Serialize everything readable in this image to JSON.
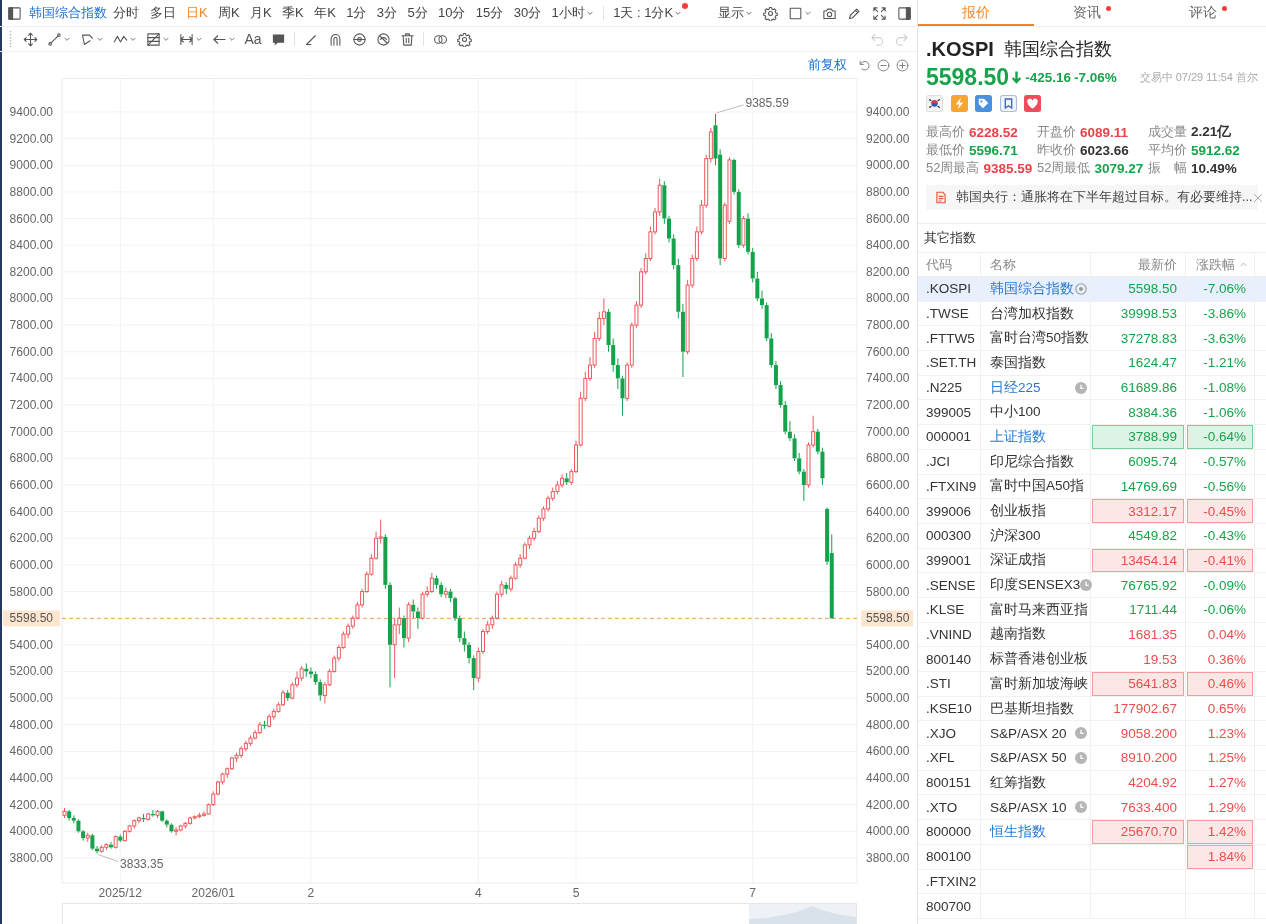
{
  "toolbar": {
    "title": "韩国综合指数",
    "periods": [
      {
        "label": "分时",
        "selected": false,
        "dropdown": false
      },
      {
        "label": "多日",
        "selected": false,
        "dropdown": false
      },
      {
        "label": "日K",
        "selected": true,
        "dropdown": false
      },
      {
        "label": "周K",
        "selected": false,
        "dropdown": false
      },
      {
        "label": "月K",
        "selected": false,
        "dropdown": false
      },
      {
        "label": "季K",
        "selected": false,
        "dropdown": false
      },
      {
        "label": "年K",
        "selected": false,
        "dropdown": false
      },
      {
        "label": "1分",
        "selected": false,
        "dropdown": false
      },
      {
        "label": "3分",
        "selected": false,
        "dropdown": false
      },
      {
        "label": "5分",
        "selected": false,
        "dropdown": false
      },
      {
        "label": "10分",
        "selected": false,
        "dropdown": false
      },
      {
        "label": "15分",
        "selected": false,
        "dropdown": false
      },
      {
        "label": "30分",
        "selected": false,
        "dropdown": false
      },
      {
        "label": "1小时",
        "selected": false,
        "dropdown": true
      }
    ],
    "interval": {
      "label": "1天 : 1分K",
      "unread": true
    },
    "display_menu": {
      "label": "显示"
    }
  },
  "drawing_toolbar": {
    "text_tool": "Aa",
    "undo": {
      "disabled": true
    },
    "redo": {
      "disabled": true
    }
  },
  "chart": {
    "adjustment": "前复权",
    "right_price_tag": "5598.50",
    "chart_data": [
      {
        "type": "candlestick",
        "categories": [
          null,
          null,
          null,
          null,
          null,
          null,
          null,
          null,
          null,
          null,
          null,
          null,
          "2025/12",
          null,
          null,
          null,
          null,
          null,
          null,
          null,
          null,
          null,
          null,
          null,
          null,
          null,
          null,
          null,
          null,
          null,
          null,
          null,
          "2026/01",
          null,
          null,
          null,
          null,
          null,
          null,
          null,
          null,
          null,
          null,
          null,
          null,
          null,
          null,
          null,
          null,
          null,
          null,
          null,
          null,
          "2",
          null,
          null,
          null,
          null,
          null,
          null,
          null,
          null,
          null,
          null,
          null,
          null,
          null,
          null,
          null,
          null,
          null,
          null,
          null,
          null,
          null,
          null,
          null,
          null,
          null,
          null,
          null,
          null,
          null,
          null,
          null,
          null,
          null,
          null,
          null,
          "4",
          null,
          null,
          null,
          null,
          null,
          null,
          null,
          null,
          null,
          null,
          null,
          null,
          null,
          null,
          null,
          null,
          null,
          null,
          null,
          null,
          "5",
          null,
          null,
          null,
          null,
          null,
          null,
          null,
          null,
          null,
          null,
          null,
          null,
          null,
          null,
          null,
          null,
          null,
          null,
          null,
          null,
          null,
          null,
          null,
          null,
          null,
          null,
          null,
          null,
          null,
          null,
          null,
          null,
          null,
          null,
          null,
          null,
          null,
          "7",
          null,
          null,
          null,
          null,
          null,
          null,
          null,
          null,
          null,
          null,
          null,
          null,
          null,
          null,
          null,
          null,
          null
        ],
        "ohlc": [
          [
            4120,
            4175,
            4100,
            4150
          ],
          [
            4150,
            4160,
            4080,
            4100
          ],
          [
            4100,
            4120,
            4060,
            4080
          ],
          [
            4080,
            4090,
            3990,
            4000
          ],
          [
            4000,
            4010,
            3930,
            3950
          ],
          [
            3950,
            3990,
            3920,
            3970
          ],
          [
            3970,
            3980,
            3860,
            3870
          ],
          [
            3870,
            3890,
            3833.35,
            3850
          ],
          [
            3850,
            3895,
            3840,
            3880
          ],
          [
            3880,
            3910,
            3860,
            3900
          ],
          [
            3900,
            3920,
            3870,
            3880
          ],
          [
            3880,
            3970,
            3870,
            3960
          ],
          [
            3960,
            3975,
            3920,
            3930
          ],
          [
            3930,
            4010,
            3925,
            4000
          ],
          [
            4000,
            4050,
            3990,
            4040
          ],
          [
            4040,
            4090,
            4020,
            4080
          ],
          [
            4080,
            4110,
            4060,
            4100
          ],
          [
            4100,
            4130,
            4070,
            4090
          ],
          [
            4090,
            4140,
            4080,
            4130
          ],
          [
            4130,
            4160,
            4110,
            4120
          ],
          [
            4120,
            4160,
            4100,
            4150
          ],
          [
            4150,
            4155,
            4070,
            4080
          ],
          [
            4080,
            4090,
            4030,
            4050
          ],
          [
            4050,
            4060,
            3990,
            4000
          ],
          [
            4000,
            4030,
            3970,
            4010
          ],
          [
            4010,
            4050,
            4000,
            4040
          ],
          [
            4040,
            4070,
            4020,
            4060
          ],
          [
            4060,
            4110,
            4050,
            4100
          ],
          [
            4100,
            4120,
            4090,
            4110
          ],
          [
            4110,
            4140,
            4100,
            4120
          ],
          [
            4120,
            4150,
            4110,
            4130
          ],
          [
            4130,
            4210,
            4125,
            4200
          ],
          [
            4200,
            4300,
            4190,
            4280
          ],
          [
            4280,
            4380,
            4270,
            4370
          ],
          [
            4370,
            4440,
            4350,
            4430
          ],
          [
            4430,
            4480,
            4400,
            4470
          ],
          [
            4470,
            4560,
            4460,
            4550
          ],
          [
            4550,
            4590,
            4520,
            4570
          ],
          [
            4570,
            4640,
            4550,
            4620
          ],
          [
            4620,
            4680,
            4600,
            4660
          ],
          [
            4660,
            4720,
            4640,
            4700
          ],
          [
            4700,
            4760,
            4690,
            4740
          ],
          [
            4740,
            4820,
            4730,
            4800
          ],
          [
            4800,
            4830,
            4770,
            4790
          ],
          [
            4790,
            4880,
            4780,
            4860
          ],
          [
            4860,
            4920,
            4840,
            4900
          ],
          [
            4900,
            4970,
            4890,
            4950
          ],
          [
            4950,
            5060,
            4940,
            5040
          ],
          [
            5040,
            5060,
            4980,
            5000
          ],
          [
            5000,
            5120,
            4990,
            5100
          ],
          [
            5100,
            5200,
            5080,
            5150
          ],
          [
            5150,
            5240,
            5130,
            5220
          ],
          [
            5220,
            5260,
            5160,
            5200
          ],
          [
            5200,
            5230,
            5150,
            5180
          ],
          [
            5180,
            5200,
            5100,
            5120
          ],
          [
            5120,
            5140,
            4980,
            5020
          ],
          [
            5020,
            5120,
            4960,
            5100
          ],
          [
            5100,
            5220,
            5090,
            5200
          ],
          [
            5200,
            5320,
            5190,
            5300
          ],
          [
            5300,
            5400,
            5280,
            5380
          ],
          [
            5380,
            5500,
            5370,
            5480
          ],
          [
            5480,
            5560,
            5450,
            5540
          ],
          [
            5540,
            5620,
            5520,
            5600
          ],
          [
            5600,
            5720,
            5590,
            5700
          ],
          [
            5700,
            5820,
            5680,
            5800
          ],
          [
            5800,
            5950,
            5790,
            5930
          ],
          [
            5930,
            6080,
            5920,
            6050
          ],
          [
            6050,
            6250,
            6040,
            6200
          ],
          [
            6200,
            6340,
            6160,
            6210
          ],
          [
            6210,
            6230,
            5820,
            5850
          ],
          [
            5850,
            5870,
            5080,
            5400
          ],
          [
            5400,
            5600,
            5150,
            5550
          ],
          [
            5550,
            5680,
            5480,
            5600
          ],
          [
            5600,
            5620,
            5380,
            5450
          ],
          [
            5450,
            5720,
            5420,
            5700
          ],
          [
            5700,
            5740,
            5600,
            5650
          ],
          [
            5650,
            5680,
            5520,
            5600
          ],
          [
            5600,
            5800,
            5590,
            5780
          ],
          [
            5780,
            5840,
            5760,
            5800
          ],
          [
            5800,
            5940,
            5790,
            5900
          ],
          [
            5900,
            5920,
            5820,
            5850
          ],
          [
            5850,
            5870,
            5760,
            5780
          ],
          [
            5780,
            5830,
            5750,
            5800
          ],
          [
            5800,
            5820,
            5720,
            5750
          ],
          [
            5750,
            5760,
            5580,
            5600
          ],
          [
            5600,
            5620,
            5420,
            5450
          ],
          [
            5450,
            5500,
            5350,
            5400
          ],
          [
            5400,
            5420,
            5260,
            5300
          ],
          [
            5300,
            5320,
            5060,
            5150
          ],
          [
            5150,
            5380,
            5120,
            5350
          ],
          [
            5350,
            5520,
            5330,
            5500
          ],
          [
            5500,
            5580,
            5480,
            5550
          ],
          [
            5550,
            5620,
            5520,
            5600
          ],
          [
            5600,
            5800,
            5590,
            5780
          ],
          [
            5780,
            5880,
            5760,
            5850
          ],
          [
            5850,
            5870,
            5780,
            5820
          ],
          [
            5820,
            5920,
            5800,
            5900
          ],
          [
            5900,
            6020,
            5890,
            6000
          ],
          [
            6000,
            6080,
            5980,
            6050
          ],
          [
            6050,
            6170,
            6040,
            6150
          ],
          [
            6150,
            6220,
            6120,
            6200
          ],
          [
            6200,
            6280,
            6180,
            6250
          ],
          [
            6250,
            6370,
            6240,
            6350
          ],
          [
            6350,
            6440,
            6330,
            6420
          ],
          [
            6420,
            6520,
            6400,
            6500
          ],
          [
            6500,
            6580,
            6480,
            6550
          ],
          [
            6550,
            6630,
            6530,
            6600
          ],
          [
            6600,
            6680,
            6580,
            6650
          ],
          [
            6650,
            6690,
            6600,
            6620
          ],
          [
            6620,
            6720,
            6600,
            6700
          ],
          [
            6700,
            6930,
            6690,
            6900
          ],
          [
            6900,
            7300,
            6890,
            7250
          ],
          [
            7250,
            7450,
            7230,
            7400
          ],
          [
            7400,
            7560,
            7380,
            7500
          ],
          [
            7500,
            7750,
            7480,
            7700
          ],
          [
            7700,
            7900,
            7680,
            7850
          ],
          [
            7850,
            8000,
            7800,
            7900
          ],
          [
            7900,
            7920,
            7600,
            7650
          ],
          [
            7650,
            7700,
            7450,
            7500
          ],
          [
            7500,
            7550,
            7320,
            7400
          ],
          [
            7400,
            7420,
            7120,
            7250
          ],
          [
            7250,
            7520,
            7230,
            7500
          ],
          [
            7500,
            7820,
            7480,
            7800
          ],
          [
            7800,
            7980,
            7780,
            7950
          ],
          [
            7950,
            8230,
            7930,
            8200
          ],
          [
            8200,
            8340,
            8180,
            8300
          ],
          [
            8300,
            8540,
            8280,
            8500
          ],
          [
            8500,
            8680,
            8480,
            8650
          ],
          [
            8650,
            8900,
            8620,
            8850
          ],
          [
            8850,
            8880,
            8560,
            8600
          ],
          [
            8600,
            8620,
            8420,
            8450
          ],
          [
            8450,
            8480,
            8220,
            8250
          ],
          [
            8250,
            8300,
            7850,
            7900
          ],
          [
            7900,
            7960,
            7410,
            7600
          ],
          [
            7600,
            8140,
            7580,
            8100
          ],
          [
            8100,
            8330,
            8080,
            8300
          ],
          [
            8300,
            8540,
            8280,
            8500
          ],
          [
            8500,
            8740,
            8480,
            8700
          ],
          [
            8700,
            9080,
            8680,
            9050
          ],
          [
            9050,
            9280,
            9020,
            9250
          ],
          [
            9300,
            9385.59,
            9000,
            9050
          ],
          [
            9080,
            9120,
            8250,
            8300
          ],
          [
            8300,
            8720,
            8280,
            8700
          ],
          [
            8580,
            9060,
            8560,
            9040
          ],
          [
            9040,
            9050,
            8780,
            8800
          ],
          [
            8800,
            8820,
            8380,
            8400
          ],
          [
            8400,
            8620,
            8380,
            8600
          ],
          [
            8600,
            8640,
            8330,
            8350
          ],
          [
            8350,
            8380,
            8120,
            8150
          ],
          [
            8150,
            8200,
            7980,
            8000
          ],
          [
            8000,
            8060,
            7920,
            7950
          ],
          [
            7950,
            7970,
            7680,
            7700
          ],
          [
            7700,
            7740,
            7480,
            7500
          ],
          [
            7500,
            7530,
            7320,
            7350
          ],
          [
            7350,
            7380,
            7180,
            7200
          ],
          [
            7200,
            7230,
            6980,
            7000
          ],
          [
            7000,
            7080,
            6930,
            6950
          ],
          [
            6950,
            6980,
            6780,
            6800
          ],
          [
            6800,
            6840,
            6680,
            6700
          ],
          [
            6700,
            6720,
            6480,
            6600
          ],
          [
            6600,
            6920,
            6580,
            6900
          ],
          [
            6900,
            7120,
            6880,
            7000
          ],
          [
            7000,
            7020,
            6830,
            6850
          ],
          [
            6850,
            6880,
            6600,
            6650
          ],
          [
            6420,
            6430,
            6000,
            6023.66
          ],
          [
            6089.11,
            6228.52,
            5596.71,
            5598.5
          ]
        ],
        "ylim": [
          3612,
          9655
        ],
        "y2lim": [
          3612,
          9655
        ],
        "yticks": [
          {
            "value": 3800,
            "label": "3800.00"
          },
          {
            "value": 4000,
            "label": "4000.00"
          },
          {
            "value": 4200,
            "label": "4200.00"
          },
          {
            "value": 4400,
            "label": "4400.00"
          },
          {
            "value": 4600,
            "label": "4600.00"
          },
          {
            "value": 4800,
            "label": "4800.00"
          },
          {
            "value": 5000,
            "label": "5000.00"
          },
          {
            "value": 5200,
            "label": "5200.00"
          },
          {
            "value": 5400,
            "label": "5400.00"
          },
          {
            "value": 5800,
            "label": "5800.00"
          },
          {
            "value": 6000,
            "label": "6000.00"
          },
          {
            "value": 6200,
            "label": "6200.00"
          },
          {
            "value": 6400,
            "label": "6400.00"
          },
          {
            "value": 6600,
            "label": "6600.00"
          },
          {
            "value": 6800,
            "label": "6800.00"
          },
          {
            "value": 7000,
            "label": "7000.00"
          },
          {
            "value": 7200,
            "label": "7200.00"
          },
          {
            "value": 7400,
            "label": "7400.00"
          },
          {
            "value": 7600,
            "label": "7600.00"
          },
          {
            "value": 7800,
            "label": "7800.00"
          },
          {
            "value": 8000,
            "label": "8000.00"
          },
          {
            "value": 8200,
            "label": "8200.00"
          },
          {
            "value": 8400,
            "label": "8400.00"
          },
          {
            "value": 8600,
            "label": "8600.00"
          },
          {
            "value": 8800,
            "label": "8800.00"
          },
          {
            "value": 9000,
            "label": "9000.00"
          },
          {
            "value": 9200,
            "label": "9200.00"
          },
          {
            "value": 9400,
            "label": "9400.00"
          }
        ],
        "y2ticks": [
          {
            "value": 3800,
            "label": "3800.00"
          },
          {
            "value": 4000,
            "label": "4000.00"
          },
          {
            "value": 4200,
            "label": "4200.00"
          },
          {
            "value": 4400,
            "label": "4400.00"
          },
          {
            "value": 4600,
            "label": "4600.00"
          },
          {
            "value": 4800,
            "label": "4800.00"
          },
          {
            "value": 5000,
            "label": "5000.00"
          },
          {
            "value": 5200,
            "label": "5200.00"
          },
          {
            "value": 5400,
            "label": "5400.00"
          },
          {
            "value": 5800,
            "label": "5800.00"
          },
          {
            "value": 6000,
            "label": "6000.00"
          },
          {
            "value": 6200,
            "label": "6200.00"
          },
          {
            "value": 6400,
            "label": "6400.00"
          },
          {
            "value": 6600,
            "label": "6600.00"
          },
          {
            "value": 6800,
            "label": "6800.00"
          },
          {
            "value": 7000,
            "label": "7000.00"
          },
          {
            "value": 7200,
            "label": "7200.00"
          },
          {
            "value": 7400,
            "label": "7400.00"
          },
          {
            "value": 7600,
            "label": "7600.00"
          },
          {
            "value": 7800,
            "label": "7800.00"
          },
          {
            "value": 8000,
            "label": "8000.00"
          },
          {
            "value": 8200,
            "label": "8200.00"
          },
          {
            "value": 8400,
            "label": "8400.00"
          },
          {
            "value": 8600,
            "label": "8600.00"
          },
          {
            "value": 8800,
            "label": "8800.00"
          },
          {
            "value": 9000,
            "label": "9000.00"
          },
          {
            "value": 9200,
            "label": "9200.00"
          },
          {
            "value": 9400,
            "label": "9400.00"
          }
        ],
        "ref_lines": [
          {
            "axis": "y",
            "value": 5598.5,
            "label": "5598.50",
            "color": "#f4a04a",
            "line_style": "dashed"
          }
        ],
        "annotations": [
          "9385.59",
          "3833.35"
        ],
        "grid": true
      }
    ]
  },
  "tabs": [
    {
      "label": "报价",
      "selected": true,
      "unread": false
    },
    {
      "label": "资讯",
      "selected": false,
      "unread": true
    },
    {
      "label": "评论",
      "selected": false,
      "unread": true
    }
  ],
  "quote": {
    "symbol": ".KOSPI",
    "name": "韩国综合指数",
    "price": "5598.50",
    "falling": true,
    "change": "-425.16",
    "change_pct": "-7.06%",
    "status": "交易中 07/29 11:54 首尔"
  },
  "stats": [
    {
      "label": "最高价",
      "value": "6228.52",
      "color": "#e8424a"
    },
    {
      "label": "开盘价",
      "value": "6089.11",
      "color": "#e8424a"
    },
    {
      "label": "成交量",
      "value": "2.21亿",
      "color": "#333333"
    },
    {
      "label": "最低价",
      "value": "5596.71",
      "color": "#17a34a"
    },
    {
      "label": "昨收价",
      "value": "6023.66",
      "color": "#333333"
    },
    {
      "label": "平均价",
      "value": "5912.62",
      "color": "#17a34a"
    },
    {
      "label": "52周最高",
      "value": "9385.59",
      "color": "#e8424a"
    },
    {
      "label": "52周最低",
      "value": "3079.27",
      "color": "#17a34a"
    },
    {
      "label": "振　幅",
      "value": "10.49%",
      "color": "#333333"
    }
  ],
  "news": {
    "text": "韩国央行：通胀将在下半年超过目标。有必要维持..."
  },
  "other_indices": {
    "title": "其它指数",
    "columns": [
      {
        "label": "代码",
        "sorted": false
      },
      {
        "label": "名称",
        "sorted": false
      },
      {
        "label": "最新价",
        "sorted": false
      },
      {
        "label": "涨跌幅",
        "sorted": true
      }
    ],
    "rows": [
      {
        "code": ".KOSPI",
        "name": "韩国综合指数",
        "price": "5598.50",
        "change": "-7.06%",
        "color": "#17a34a",
        "highlighted": false,
        "selected": true,
        "link": true,
        "watching": true,
        "delayed": false
      },
      {
        "code": ".TWSE",
        "name": "台湾加权指数",
        "price": "39998.53",
        "change": "-3.86%",
        "color": "#17a34a",
        "highlighted": false,
        "selected": false,
        "link": false,
        "watching": false,
        "delayed": false
      },
      {
        "code": ".FTTW5",
        "name": "富时台湾50指数",
        "price": "37278.83",
        "change": "-3.63%",
        "color": "#17a34a",
        "highlighted": false,
        "selected": false,
        "link": false,
        "watching": false,
        "delayed": false
      },
      {
        "code": ".SET.TH",
        "name": "泰国指数",
        "price": "1624.47",
        "change": "-1.21%",
        "color": "#17a34a",
        "highlighted": false,
        "selected": false,
        "link": false,
        "watching": false,
        "delayed": false
      },
      {
        "code": ".N225",
        "name": "日经225",
        "price": "61689.86",
        "change": "-1.08%",
        "color": "#17a34a",
        "highlighted": false,
        "selected": false,
        "link": true,
        "watching": false,
        "delayed": true
      },
      {
        "code": "399005",
        "name": "中小100",
        "price": "8384.36",
        "change": "-1.06%",
        "color": "#17a34a",
        "highlighted": false,
        "selected": false,
        "link": false,
        "watching": false,
        "delayed": false
      },
      {
        "code": "000001",
        "name": "上证指数",
        "price": "3788.99",
        "change": "-0.64%",
        "color": "#17a34a",
        "highlighted": true,
        "selected": false,
        "link": true,
        "watching": false,
        "delayed": false
      },
      {
        "code": ".JCI",
        "name": "印尼综合指数",
        "price": "6095.74",
        "change": "-0.57%",
        "color": "#17a34a",
        "highlighted": false,
        "selected": false,
        "link": false,
        "watching": false,
        "delayed": false
      },
      {
        "code": ".FTXIN9",
        "name": "富时中国A50指",
        "price": "14769.69",
        "change": "-0.56%",
        "color": "#17a34a",
        "highlighted": false,
        "selected": false,
        "link": false,
        "watching": false,
        "delayed": false
      },
      {
        "code": "399006",
        "name": "创业板指",
        "price": "3312.17",
        "change": "-0.45%",
        "color": "#ec4d4d",
        "highlighted": true,
        "selected": false,
        "link": false,
        "watching": false,
        "delayed": false
      },
      {
        "code": "000300",
        "name": "沪深300",
        "price": "4549.82",
        "change": "-0.43%",
        "color": "#17a34a",
        "highlighted": false,
        "selected": false,
        "link": false,
        "watching": false,
        "delayed": false
      },
      {
        "code": "399001",
        "name": "深证成指",
        "price": "13454.14",
        "change": "-0.41%",
        "color": "#ec4d4d",
        "highlighted": true,
        "selected": false,
        "link": false,
        "watching": false,
        "delayed": false
      },
      {
        "code": ".SENSE",
        "name": "印度SENSEX3",
        "price": "76765.92",
        "change": "-0.09%",
        "color": "#17a34a",
        "highlighted": false,
        "selected": false,
        "link": false,
        "watching": false,
        "delayed": true
      },
      {
        "code": ".KLSE",
        "name": "富时马来西亚指",
        "price": "1711.44",
        "change": "-0.06%",
        "color": "#17a34a",
        "highlighted": false,
        "selected": false,
        "link": false,
        "watching": false,
        "delayed": false
      },
      {
        "code": ".VNIND",
        "name": "越南指数",
        "price": "1681.35",
        "change": "0.04%",
        "color": "#ec4d4d",
        "highlighted": false,
        "selected": false,
        "link": false,
        "watching": false,
        "delayed": false
      },
      {
        "code": "800140",
        "name": "标普香港创业板",
        "price": "19.53",
        "change": "0.36%",
        "color": "#ec4d4d",
        "highlighted": false,
        "selected": false,
        "link": false,
        "watching": false,
        "delayed": false
      },
      {
        "code": ".STI",
        "name": "富时新加坡海峡",
        "price": "5641.83",
        "change": "0.46%",
        "color": "#ec4d4d",
        "highlighted": true,
        "selected": false,
        "link": false,
        "watching": false,
        "delayed": false
      },
      {
        "code": ".KSE10",
        "name": "巴基斯坦指数",
        "price": "177902.67",
        "change": "0.65%",
        "color": "#ec4d4d",
        "highlighted": false,
        "selected": false,
        "link": false,
        "watching": false,
        "delayed": false
      },
      {
        "code": ".XJO",
        "name": "S&P/ASX 20",
        "price": "9058.200",
        "change": "1.23%",
        "color": "#ec4d4d",
        "highlighted": false,
        "selected": false,
        "link": false,
        "watching": false,
        "delayed": true
      },
      {
        "code": ".XFL",
        "name": "S&P/ASX 50",
        "price": "8910.200",
        "change": "1.25%",
        "color": "#ec4d4d",
        "highlighted": false,
        "selected": false,
        "link": false,
        "watching": false,
        "delayed": true
      },
      {
        "code": "800151",
        "name": "红筹指数",
        "price": "4204.92",
        "change": "1.27%",
        "color": "#ec4d4d",
        "highlighted": false,
        "selected": false,
        "link": false,
        "watching": false,
        "delayed": false
      },
      {
        "code": ".XTO",
        "name": "S&P/ASX 10",
        "price": "7633.400",
        "change": "1.29%",
        "color": "#ec4d4d",
        "highlighted": false,
        "selected": false,
        "link": false,
        "watching": false,
        "delayed": true
      },
      {
        "code": "800000",
        "name": "恒生指数",
        "price": "25670.70",
        "change": "1.42%",
        "color": "#ec4d4d",
        "highlighted": true,
        "selected": false,
        "link": true,
        "watching": false,
        "delayed": false
      },
      {
        "code": "800100",
        "change": "1.84%",
        "color": "#ec4d4d",
        "highlighted": true,
        "selected": false
      },
      {
        "code": ".FTXIN2",
        "selected": false
      },
      {
        "code": "800700",
        "selected": false
      }
    ]
  }
}
